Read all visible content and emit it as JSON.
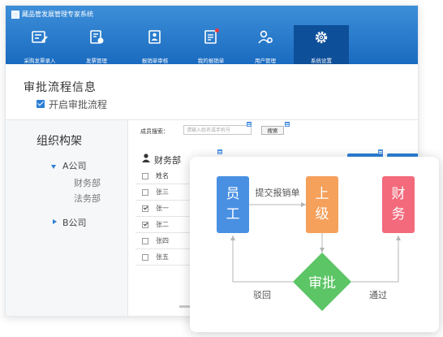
{
  "window": {
    "app_title": "藏品管发展管理专家系统"
  },
  "nav": {
    "items": [
      {
        "label": "采购发票录入",
        "icon": "invoice-entry-icon"
      },
      {
        "label": "发票管理",
        "icon": "invoice-manage-icon"
      },
      {
        "label": "报销单审核",
        "icon": "reimburse-review-icon"
      },
      {
        "label": "我的报销单",
        "icon": "my-reimburse-icon"
      },
      {
        "label": "用户管理",
        "icon": "users-gear-icon"
      },
      {
        "label": "系统设置",
        "icon": "gear-icon",
        "active": true
      }
    ]
  },
  "page": {
    "title": "审批流程信息",
    "enable_flow": {
      "label": "开启审批流程",
      "checked": true
    }
  },
  "org": {
    "title": "组织构架",
    "companies": [
      {
        "name": "A公司",
        "expanded": true,
        "departments": [
          "财务部",
          "法务部"
        ]
      },
      {
        "name": "B公司",
        "expanded": false
      }
    ]
  },
  "members": {
    "search_label": "成员搜索：",
    "search_placeholder": "请输入姓名或手机号",
    "search_button": "搜索",
    "dept_name": "财务部",
    "table": {
      "header": "姓名",
      "rows": [
        {
          "name": "张三",
          "checked": false
        },
        {
          "name": "张一",
          "checked": true
        },
        {
          "name": "张二",
          "checked": true
        },
        {
          "name": "张四",
          "checked": false
        },
        {
          "name": "张五",
          "checked": false
        }
      ]
    }
  },
  "flow": {
    "nodes": {
      "employee": {
        "label": "员工",
        "color": "#4a90e2"
      },
      "superior": {
        "label": "上级",
        "color": "#f5a05b"
      },
      "finance": {
        "label": "财务",
        "color": "#f36a7c"
      },
      "approve": {
        "label": "审批",
        "color": "#5cc565"
      }
    },
    "edges": {
      "submit": "提交报销单",
      "reject": "驳回",
      "pass": "通过"
    }
  },
  "colors": {
    "topbar": "#1a6bc0",
    "nav_active": "#0e4f99",
    "accent": "#2d7fd6"
  }
}
